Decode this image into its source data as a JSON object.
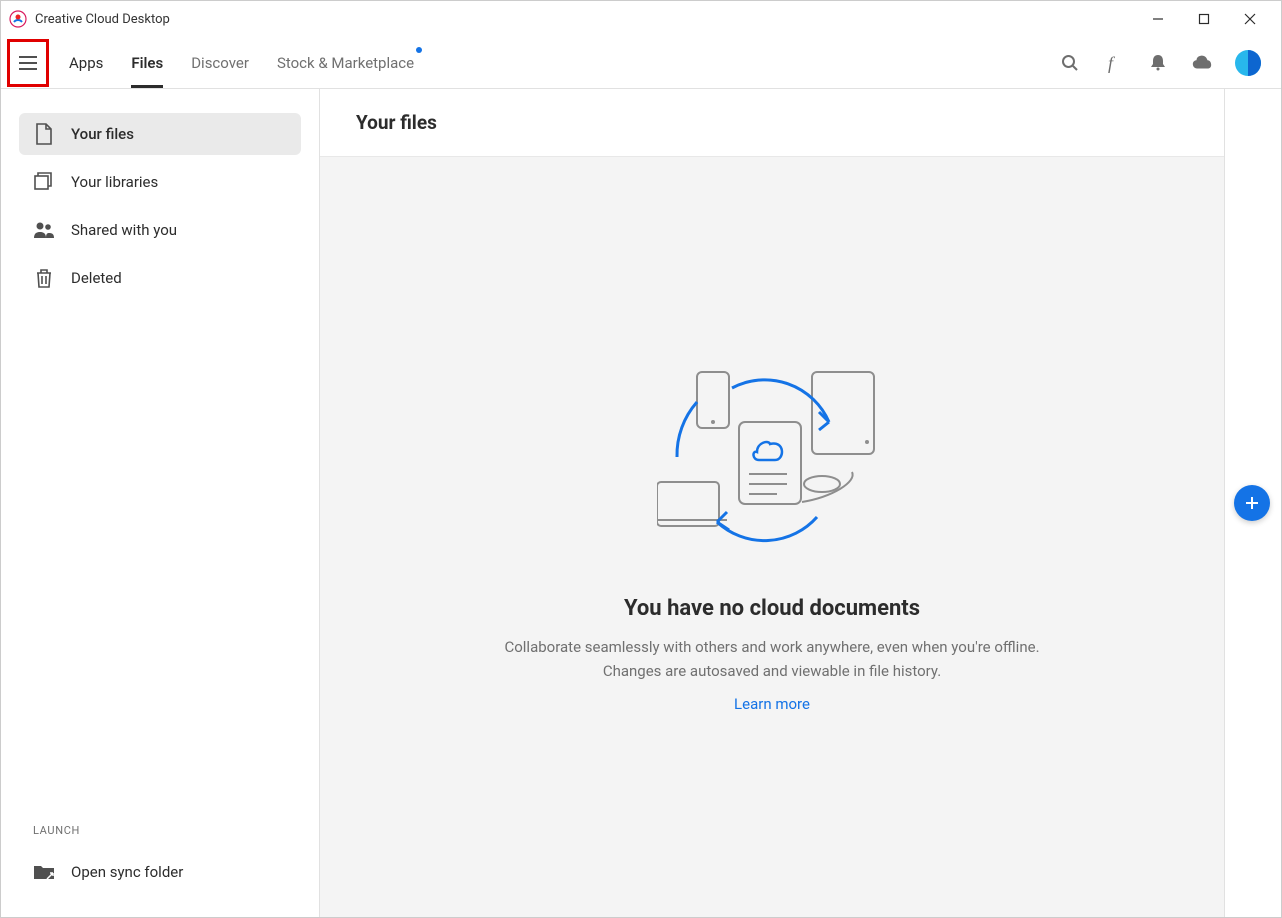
{
  "title": "Creative Cloud Desktop",
  "nav": {
    "tabs": [
      "Apps",
      "Files",
      "Discover",
      "Stock & Marketplace"
    ],
    "active_index": 1
  },
  "sidebar": {
    "items": [
      {
        "label": "Your files"
      },
      {
        "label": "Your libraries"
      },
      {
        "label": "Shared with you"
      },
      {
        "label": "Deleted"
      }
    ],
    "launch_label": "LAUNCH",
    "open_sync": "Open sync folder"
  },
  "main": {
    "title": "Your files",
    "empty": {
      "heading": "You have no cloud documents",
      "desc": "Collaborate seamlessly with others and work anywhere, even when you're offline. Changes are autosaved and viewable in file history.",
      "link": "Learn more"
    }
  }
}
